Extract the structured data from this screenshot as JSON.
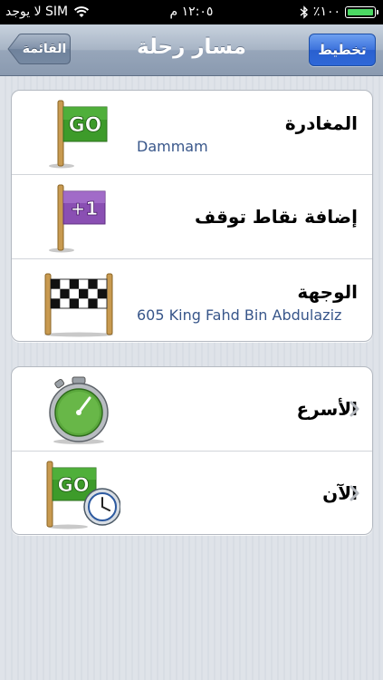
{
  "status_bar": {
    "carrier": "لا يوجد SIM",
    "time": "١٢:٠٥ م",
    "battery_percent": "٪١٠٠",
    "battery_level": 1.0,
    "icons": [
      "wifi-icon",
      "bluetooth-icon",
      "battery-icon"
    ]
  },
  "nav": {
    "title": "مسار رحلة",
    "plan_button": "تخطيط",
    "back_button": "القائمة"
  },
  "route_group": {
    "rows": [
      {
        "title": "المغادرة",
        "subtitle": "Dammam",
        "icon": "go-flag-icon",
        "icon_text": "GO"
      },
      {
        "title": "إضافة نقاط توقف",
        "subtitle": "",
        "icon": "add-stop-flag-icon",
        "icon_text": "+1"
      },
      {
        "title": "الوجهة",
        "subtitle": "605 King Fahd Bin Abdulaziz",
        "icon": "checkered-flag-icon"
      }
    ]
  },
  "options_group": {
    "rows": [
      {
        "title": "الأسرع",
        "icon": "stopwatch-icon"
      },
      {
        "title": "الآن",
        "icon": "go-flag-clock-icon",
        "icon_text": "GO"
      }
    ]
  },
  "colors": {
    "go_green": "#3d9b2a",
    "plus_purple": "#8a4fb3",
    "nav_button_blue": "#2f68d8",
    "subtitle_blue": "#38568a"
  }
}
